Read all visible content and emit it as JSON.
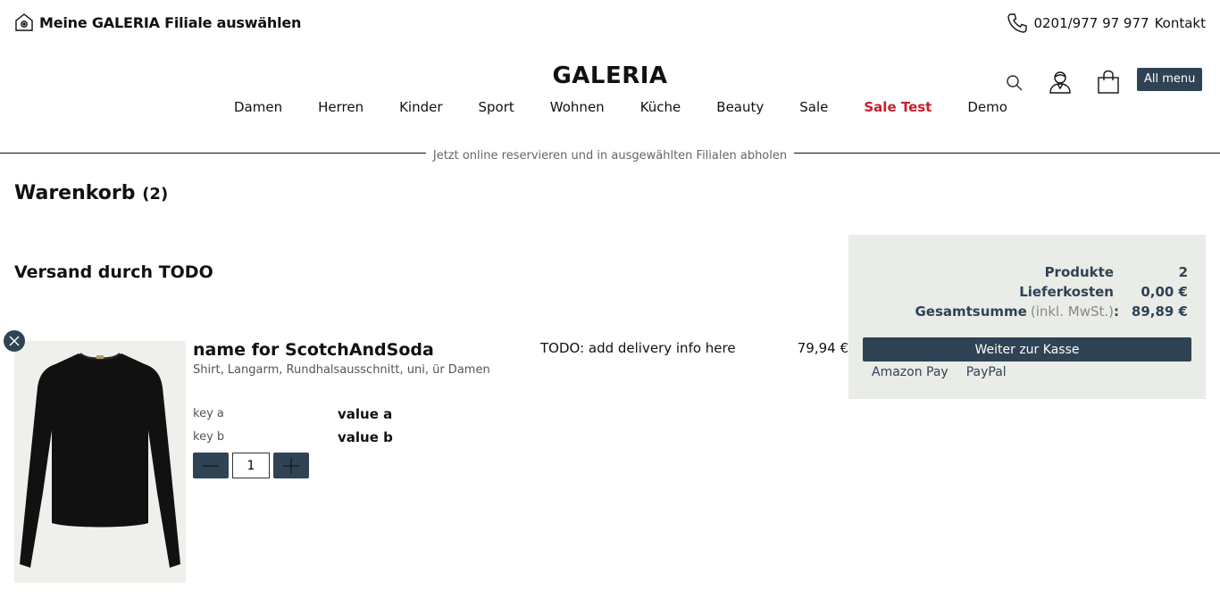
{
  "header": {
    "store_select_label": "Meine GALERIA Filiale auswählen",
    "phone": "0201/977 97 977",
    "contact_label": "Kontakt",
    "logo": "GALERIA",
    "all_menu_label": "All menu"
  },
  "nav": {
    "items": [
      {
        "label": "Damen"
      },
      {
        "label": "Herren"
      },
      {
        "label": "Kinder"
      },
      {
        "label": "Sport"
      },
      {
        "label": "Wohnen"
      },
      {
        "label": "Küche"
      },
      {
        "label": "Beauty"
      },
      {
        "label": "Sale"
      },
      {
        "label": "Sale Test",
        "highlight_color": "#c8202b"
      },
      {
        "label": "Demo"
      }
    ]
  },
  "banner_text": "Jetzt online reservieren und in ausgewählten Filialen abholen",
  "cart": {
    "title": "Warenkorb",
    "count": "(2)",
    "shipping_title": "Versand durch TODO"
  },
  "product": {
    "name": "name for ScotchAndSoda",
    "description": "Shirt, Langarm, Rundhalsausschnitt, uni, ür Damen",
    "attributes": [
      {
        "key": "key a",
        "value": "value a"
      },
      {
        "key": "key b",
        "value": "value b"
      }
    ],
    "quantity": "1",
    "delivery_info": "TODO: add delivery info here",
    "price": "79,94 €"
  },
  "summary": {
    "products_label": "Produkte",
    "products_value": "2",
    "shipping_label": "Lieferkosten",
    "shipping_value": "0,00 €",
    "total_label": "Gesamtsumme",
    "total_note": "(inkl. MwSt.)",
    "total_colon": ":",
    "total_value": "89,89 €",
    "checkout_label": "Weiter zur Kasse",
    "payment_options": [
      "Amazon Pay",
      "PayPal"
    ]
  },
  "colors": {
    "accent": "#2f4354",
    "sale": "#c8202b",
    "summary_bg": "#e9ece7"
  },
  "icons": {
    "store": "store-icon",
    "phone": "phone-icon",
    "search": "search-icon",
    "account": "account-icon",
    "cart": "shopping-bag-icon",
    "remove": "close-icon",
    "minus": "minus-icon",
    "plus": "plus-icon"
  }
}
